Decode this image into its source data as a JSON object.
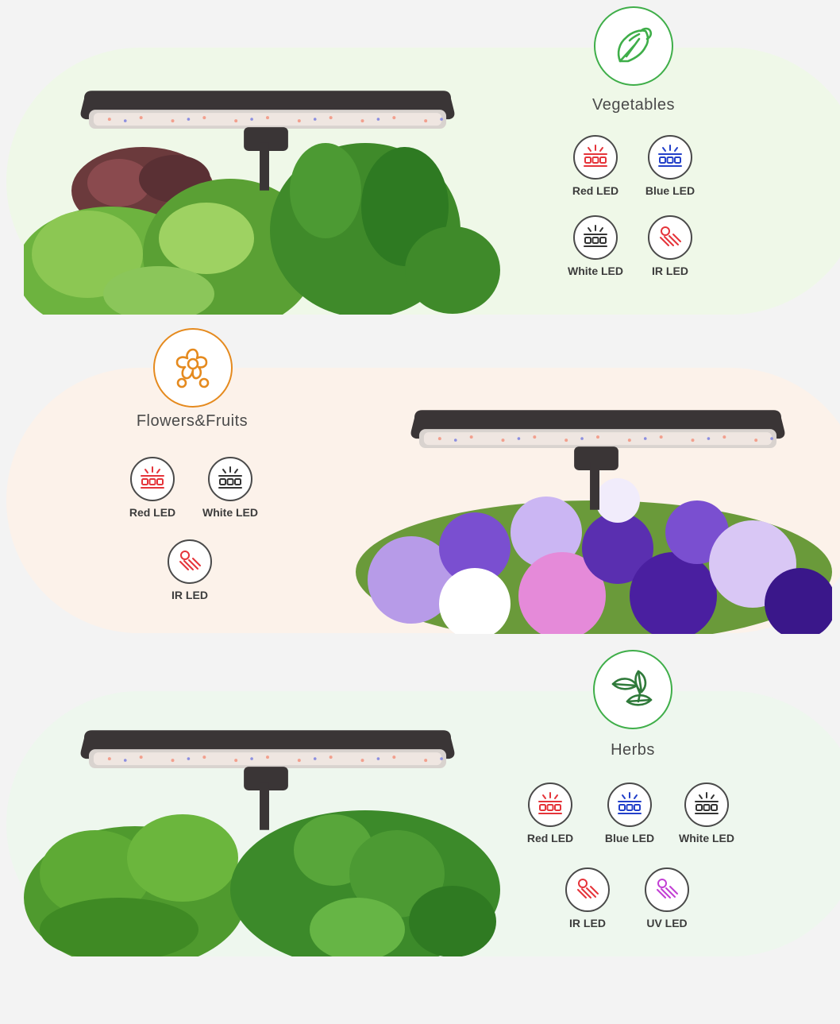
{
  "colors": {
    "vegetables_accent": "#3fae49",
    "flowers_accent": "#e58a1e",
    "herbs_accent": "#3fae49",
    "red_led": "#e5343a",
    "blue_led": "#2340c9",
    "white_led": "#333333",
    "ir_led": "#e5343a",
    "uv_led": "#c23fd4"
  },
  "categories": [
    {
      "name": "Vegetables",
      "icon": "lettuce-icon",
      "leds": [
        {
          "label": "Red LED",
          "icon": "red-led-icon"
        },
        {
          "label": "Blue LED",
          "icon": "blue-led-icon"
        },
        {
          "label": "White LED",
          "icon": "white-led-icon"
        },
        {
          "label": "IR LED",
          "icon": "ir-led-icon"
        }
      ]
    },
    {
      "name": "Flowers&Fruits",
      "icon": "flower-icon",
      "leds": [
        {
          "label": "Red LED",
          "icon": "red-led-icon"
        },
        {
          "label": "White LED",
          "icon": "white-led-icon"
        },
        {
          "label": "IR LED",
          "icon": "ir-led-icon"
        }
      ]
    },
    {
      "name": "Herbs",
      "icon": "herb-leaves-icon",
      "leds": [
        {
          "label": "Red LED",
          "icon": "red-led-icon"
        },
        {
          "label": "Blue LED",
          "icon": "blue-led-icon"
        },
        {
          "label": "White LED",
          "icon": "white-led-icon"
        },
        {
          "label": "IR LED",
          "icon": "ir-led-icon"
        },
        {
          "label": "UV LED",
          "icon": "uv-led-icon"
        }
      ]
    }
  ]
}
